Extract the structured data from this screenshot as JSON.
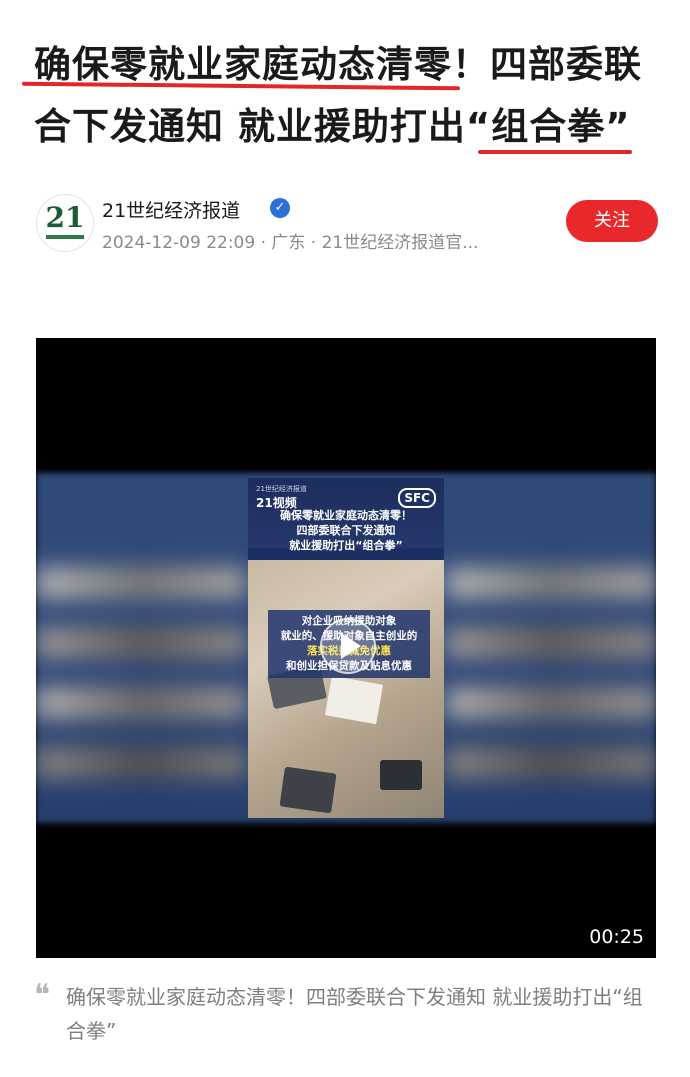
{
  "article": {
    "headline": "确保零就业家庭动态清零！四部委联合下发通知 就业援助打出“组合拳”",
    "author": {
      "name": "21世纪经济报道",
      "logo_text": "21",
      "meta": "2024-12-09 22:09 · 广东 · 21世纪经济报道官...",
      "follow_label": "关注",
      "verified_icon": "verified-badge-icon"
    },
    "video": {
      "duration": "00:25",
      "brand_small": "21世纪经济报道",
      "brand_big": "21视频",
      "badge": "SFC",
      "poster_title": [
        "确保零就业家庭动态清零！",
        "四部委联合下发通知",
        "就业援助打出“组合拳”"
      ],
      "caption_lines": [
        "对企业吸纳援助对象",
        "就业的、援助对象自主创业的",
        "落实税费减免优惠",
        "和创业担保贷款及贴息优惠"
      ]
    },
    "quote_mark": "❝",
    "quote": "确保零就业家庭动态清零！四部委联合下发通知 就业援助打出“组合拳”"
  },
  "colors": {
    "accent_red": "#e8282b",
    "verified_blue": "#2c6fd8",
    "text_dark": "#1a1a1a",
    "text_gray": "#8a8a8a"
  }
}
